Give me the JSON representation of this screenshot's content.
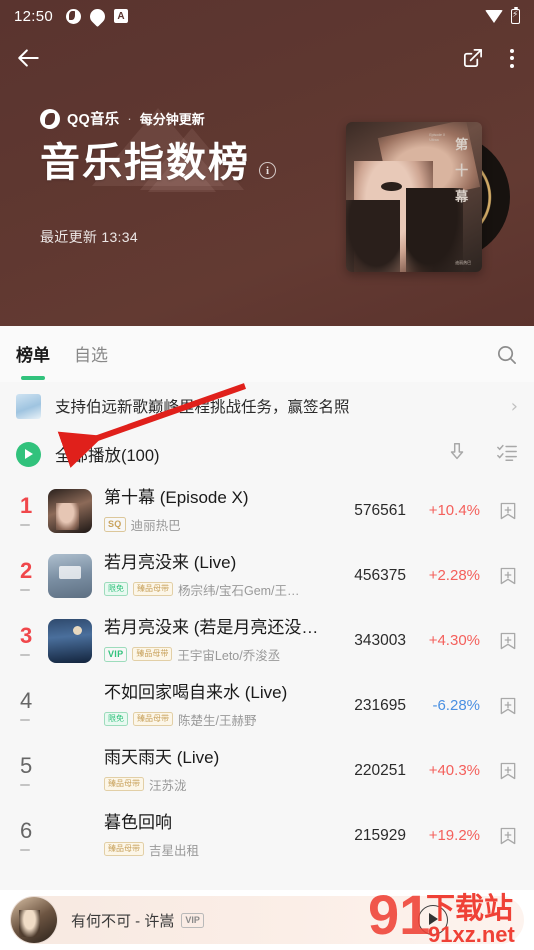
{
  "status_bar": {
    "time": "12:50",
    "left_icons": [
      "browser-icon",
      "location-icon",
      "app-badge-icon"
    ],
    "right_icons": [
      "wifi-icon",
      "battery-charging-icon"
    ]
  },
  "top_nav": {
    "back_icon": "back-arrow-icon",
    "share_icon": "share-external-icon",
    "more_icon": "more-vertical-icon"
  },
  "hero": {
    "brand": "QQ音乐",
    "separator": "·",
    "brand_sub": "每分钟更新",
    "title": "音乐指数榜",
    "info_icon": "i",
    "updated": "最近更新 13:34",
    "bg_color": "#5e3730",
    "album_vertical_text": [
      "第",
      "十",
      "幕"
    ],
    "album_micro_text": "Episode X\nUltraa",
    "album_signature": "迪丽热巴"
  },
  "tabs": {
    "items": [
      {
        "label": "榜单",
        "active": true
      },
      {
        "label": "自选",
        "active": false
      }
    ],
    "search_icon": "search-icon",
    "accent_color": "#31c27c"
  },
  "banner": {
    "text": "支持伯远新歌巅峰里程挑战任务，赢签名照",
    "chevron": "›"
  },
  "play_all": {
    "label": "全部播放(100)",
    "play_icon": "play-circle-icon",
    "download_icon": "download-icon",
    "multiselect_icon": "multiselect-list-icon"
  },
  "list": {
    "columns": [
      "rank",
      "cover",
      "title",
      "badges",
      "artist",
      "score",
      "delta",
      "add"
    ],
    "rows": [
      {
        "rank": "1",
        "top": true,
        "trend": "flat",
        "cover": "c1",
        "title": "第十幕 (Episode X)",
        "badges": [
          {
            "text": "SQ",
            "style": "sq"
          }
        ],
        "artist": "迪丽热巴",
        "score": "576561",
        "delta": "+10.4%",
        "delta_dir": "up"
      },
      {
        "rank": "2",
        "top": true,
        "trend": "flat",
        "cover": "c2",
        "title": "若月亮没来 (Live)",
        "badges": [
          {
            "text": "限免",
            "style": "free"
          },
          {
            "text": "臻品母带",
            "style": "master"
          }
        ],
        "artist": "杨宗纬/宝石Gem/王…",
        "score": "456375",
        "delta": "+2.28%",
        "delta_dir": "up"
      },
      {
        "rank": "3",
        "top": true,
        "trend": "flat",
        "cover": "c3",
        "title": "若月亮没来 (若是月亮还没…",
        "badges": [
          {
            "text": "VIP",
            "style": "vip"
          },
          {
            "text": "臻品母带",
            "style": "master"
          }
        ],
        "artist": "王宇宙Leto/乔浚丞",
        "score": "343003",
        "delta": "+4.30%",
        "delta_dir": "up"
      },
      {
        "rank": "4",
        "top": false,
        "trend": "flat",
        "cover": "placeholder",
        "title": "不如回家喝自来水 (Live)",
        "badges": [
          {
            "text": "限免",
            "style": "free"
          },
          {
            "text": "臻品母带",
            "style": "master"
          }
        ],
        "artist": "陈楚生/王赫野",
        "score": "231695",
        "delta": "-6.28%",
        "delta_dir": "down"
      },
      {
        "rank": "5",
        "top": false,
        "trend": "flat",
        "cover": "placeholder",
        "title": "雨天雨天 (Live)",
        "badges": [
          {
            "text": "臻品母带",
            "style": "master"
          }
        ],
        "artist": "汪苏泷",
        "score": "220251",
        "delta": "+40.3%",
        "delta_dir": "up"
      },
      {
        "rank": "6",
        "top": false,
        "trend": "flat",
        "cover": "placeholder",
        "title": "暮色回响",
        "badges": [
          {
            "text": "臻品母带",
            "style": "master"
          }
        ],
        "artist": "吉星出租",
        "score": "215929",
        "delta": "+19.2%",
        "delta_dir": "up"
      }
    ]
  },
  "player": {
    "title": "有何不可 - 许嵩",
    "vip_badge": "VIP",
    "play_icon": "play-outline-icon"
  },
  "annotation": {
    "arrow_color": "#e0201b",
    "description": "red-arrow-pointing-to-play-all"
  },
  "watermark": {
    "primary": "91",
    "title": "下载站",
    "url": "91xz.net",
    "color": "#ef4136"
  },
  "colors": {
    "up": "#f4605c",
    "down": "#4a90e2",
    "rank_top": "#f0474b",
    "accent": "#31c27c",
    "header_bg": "#5e3730"
  }
}
